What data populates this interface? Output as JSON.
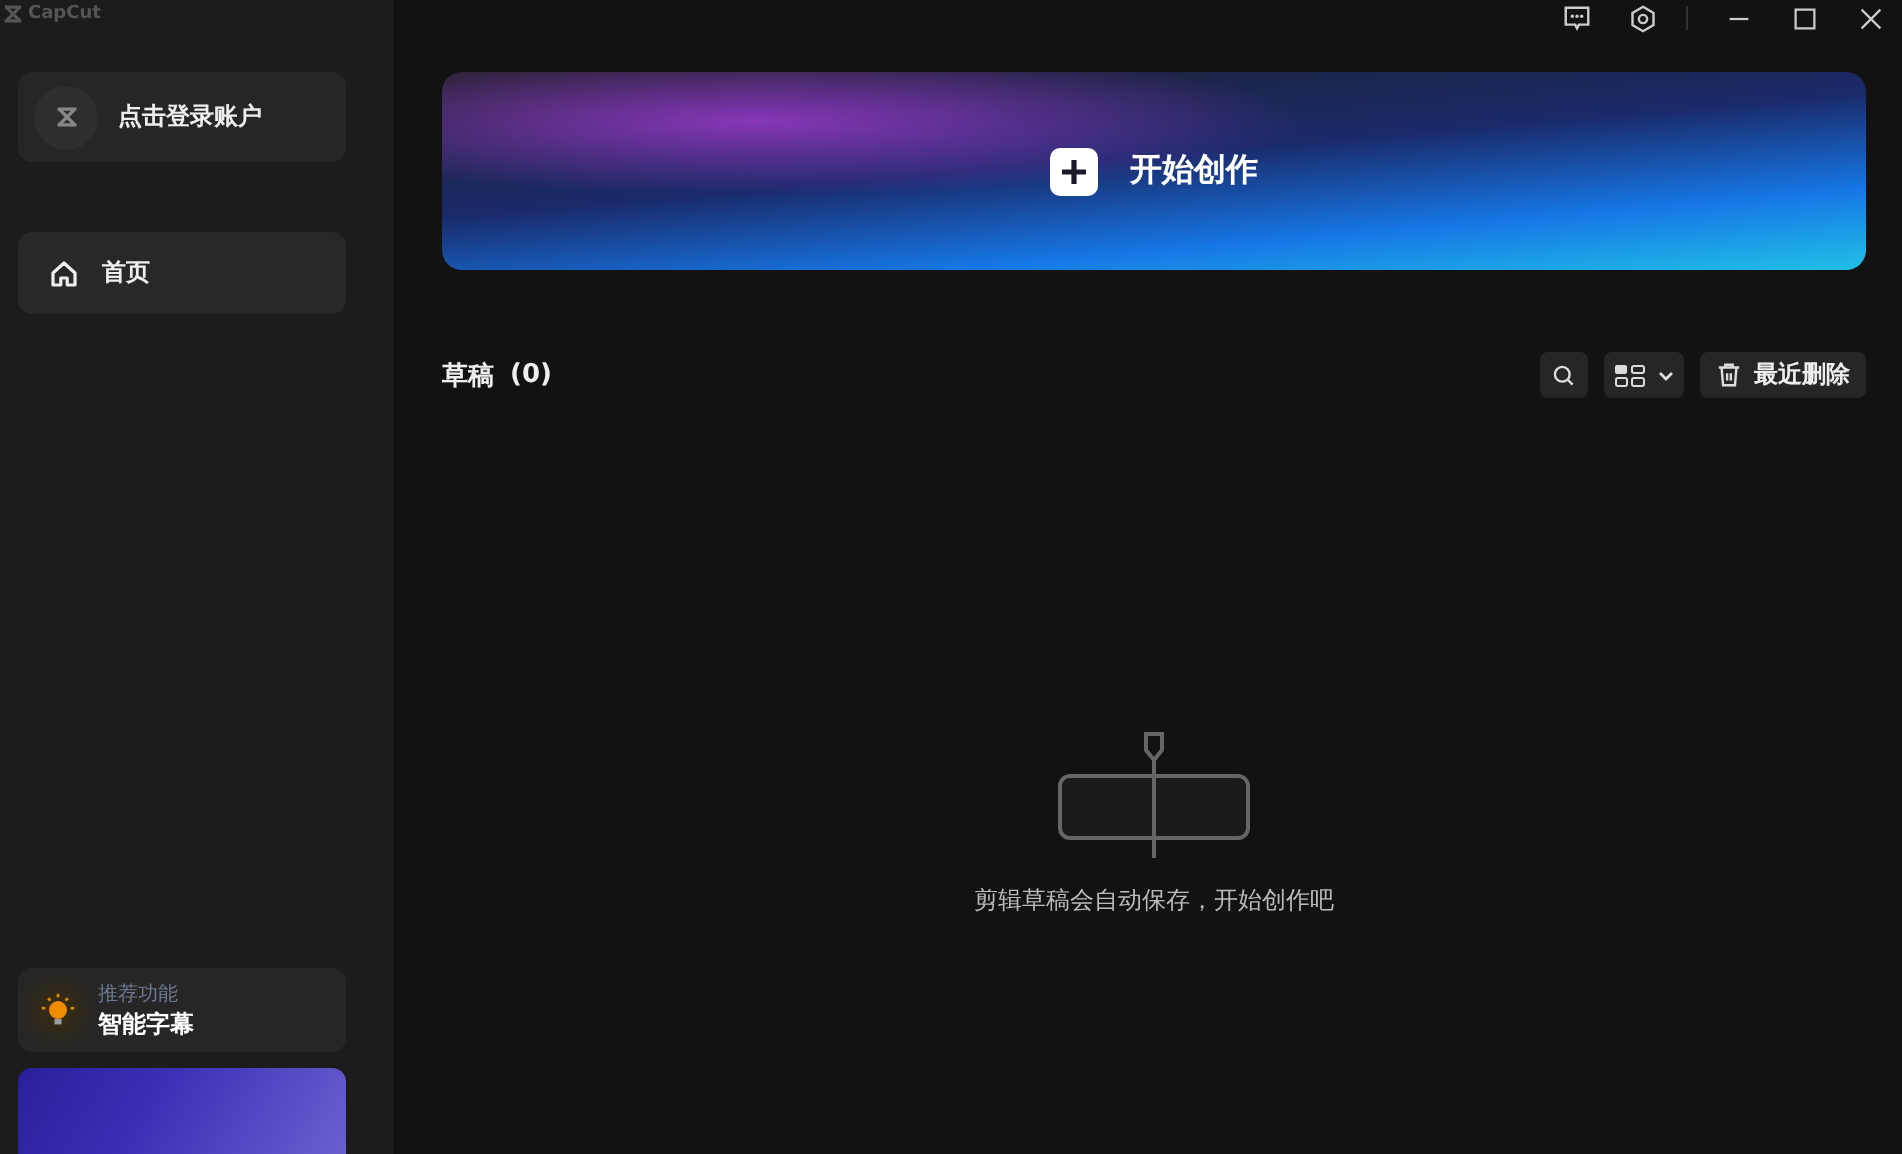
{
  "app_title": "CapCut",
  "account": {
    "label": "点击登录账户"
  },
  "nav": [
    {
      "label": "首页",
      "selected": true
    }
  ],
  "feature": {
    "caption": "推荐功能",
    "title": "智能字幕"
  },
  "banner": {
    "label": "开始创作"
  },
  "drafts": {
    "title": "草稿",
    "count": "(0)",
    "trash_button": "最近删除"
  },
  "empty_state": {
    "message": "剪辑草稿会自动保存，开始创作吧"
  }
}
